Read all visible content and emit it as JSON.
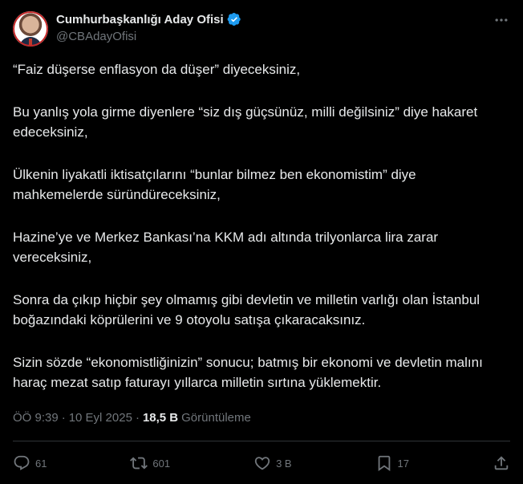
{
  "author": {
    "display_name": "Cumhurbaşkanlığı Aday Ofisi",
    "handle": "@CBAdayOfisi",
    "verified_color": "#1d9bf0"
  },
  "tweet": {
    "paragraphs": [
      "“Faiz düşerse enflasyon da düşer” diyeceksiniz,",
      "Bu yanlış yola girme diyenlere “siz dış güçsünüz, milli değilsiniz” diye hakaret edeceksiniz,",
      "Ülkenin liyakatli iktisatçılarını “bunlar bilmez ben ekonomistim” diye mahkemelerde süründüreceksiniz,",
      "Hazine’ye ve Merkez Bankası’na KKM adı altında trilyonlarca lira zarar vereceksiniz,",
      "Sonra da çıkıp hiçbir şey olmamış gibi devletin ve milletin varlığı olan İstanbul boğazındaki köprülerini ve 9 otoyolu satışa çıkaracaksınız.",
      "Sizin sözde “ekonomistliğinizin” sonucu; batmış bir ekonomi ve devletin malını haraç mezat satıp faturayı yıllarca milletin sırtına yüklemektir."
    ],
    "time": "ÖÖ 9:39",
    "separator": "·",
    "date": "10 Eyl 2025",
    "views_count": "18,5 B",
    "views_label": "Görüntüleme"
  },
  "actions": {
    "replies": "61",
    "retweets": "601",
    "likes": "3 B",
    "bookmarks": "17"
  },
  "icons": {
    "more": "more-horizontal-icon",
    "reply": "reply-icon",
    "retweet": "retweet-icon",
    "like": "heart-icon",
    "bookmark": "bookmark-icon",
    "share": "share-icon",
    "verified": "verified-badge-icon"
  }
}
